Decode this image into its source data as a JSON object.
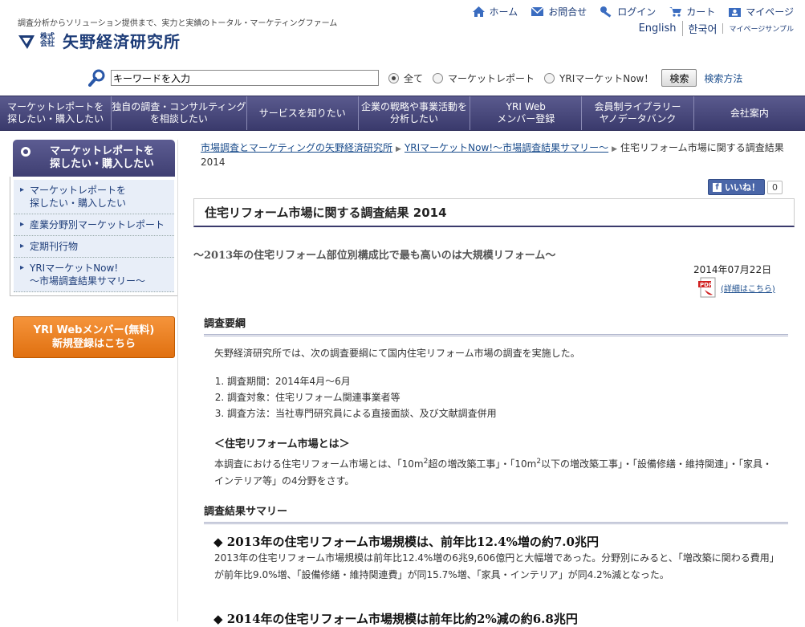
{
  "header": {
    "tagline": "調査分析からソリューション提供まで、実力と実績のトータル・マーケティングファーム",
    "logo_sub": "株式会社",
    "logo_name": "矢野経済研究所",
    "topnav": [
      {
        "label": "ホーム",
        "icon": "home-icon"
      },
      {
        "label": "お問合せ",
        "icon": "mail-icon"
      },
      {
        "label": "ログイン",
        "icon": "key-icon"
      },
      {
        "label": "カート",
        "icon": "cart-icon"
      },
      {
        "label": "マイページ",
        "icon": "mypage-icon"
      }
    ],
    "langnav": [
      "English",
      "한국어",
      "マイページサンプル"
    ]
  },
  "search": {
    "value": "キーワードを入力",
    "options": [
      "全て",
      "マーケットレポート",
      "YRIマーケットNow！"
    ],
    "selected": "全て",
    "button": "検索",
    "help": "検索方法"
  },
  "mainnav": [
    "マーケットレポートを\n探したい・購入したい",
    "独自の調査・コンサルティング\nを相談したい",
    "サービスを知りたい",
    "企業の戦略や事業活動を\n分析したい",
    "YRI Web\nメンバー登録",
    "会員制ライブラリー\nヤノデータバンク",
    "会社案内"
  ],
  "sidebar": {
    "heading": "マーケットレポートを\n探したい・購入したい",
    "items": [
      "マーケットレポートを\n探したい・購入したい",
      "産業分野別マーケットレポート",
      "定期刊行物",
      "YRIマーケットNow!\n～市場調査結果サマリー～"
    ],
    "cta_line1": "YRI Webメンバー(無料)",
    "cta_line2": "新規登録はこちら"
  },
  "breadcrumb": {
    "links": [
      "市場調査とマーケティングの矢野経済研究所",
      "YRIマーケットNow!～市場調査結果サマリー～"
    ],
    "current": "住宅リフォーム市場に関する調査結果 2014"
  },
  "like": {
    "label": "いいね！",
    "count": "0"
  },
  "article": {
    "title": "住宅リフォーム市場に関する調査結果 2014",
    "subtitle": "～2013年の住宅リフォーム部位別構成比で最も高いのは大規模リフォーム～",
    "date": "2014年07月22日",
    "pdf_link": "(詳細はこちら)",
    "section1_heading": "調査要綱",
    "intro": "矢野経済研究所では、次の調査要綱にて国内住宅リフォーム市場の調査を実施した。",
    "outline": [
      "調査期間：2014年4月～6月",
      "調査対象：住宅リフォーム関連事業者等",
      "調査方法：当社専門研究員による直接面談、及び文献調査併用"
    ],
    "definition_heading": "＜住宅リフォーム市場とは＞",
    "definition_a": "本調査における住宅リフォーム市場とは、「10m",
    "definition_sup1": "2",
    "definition_b": "超の増改築工事」・「10m",
    "definition_sup2": "2",
    "definition_c": "以下の増改築工事」・「設備修繕・維持関連」・「家具・インテリア等」の4分野をさす。",
    "section2_heading": "調査結果サマリー",
    "summary1_heading": "◆ 2013年の住宅リフォーム市場規模は、前年比12.4%増の約7.0兆円",
    "summary1_body": "2013年の住宅リフォーム市場規模は前年比12.4%増の6兆9,606億円と大幅増であった。分野別にみると、「増改築に関わる費用」が前年比9.0%増、「設備修繕・維持関連費」が同15.7%増、「家具・インテリア」が同4.2%減となった。",
    "summary2_heading": "◆ 2014年の住宅リフォーム市場規模は前年比約2%減の約6.8兆円"
  }
}
